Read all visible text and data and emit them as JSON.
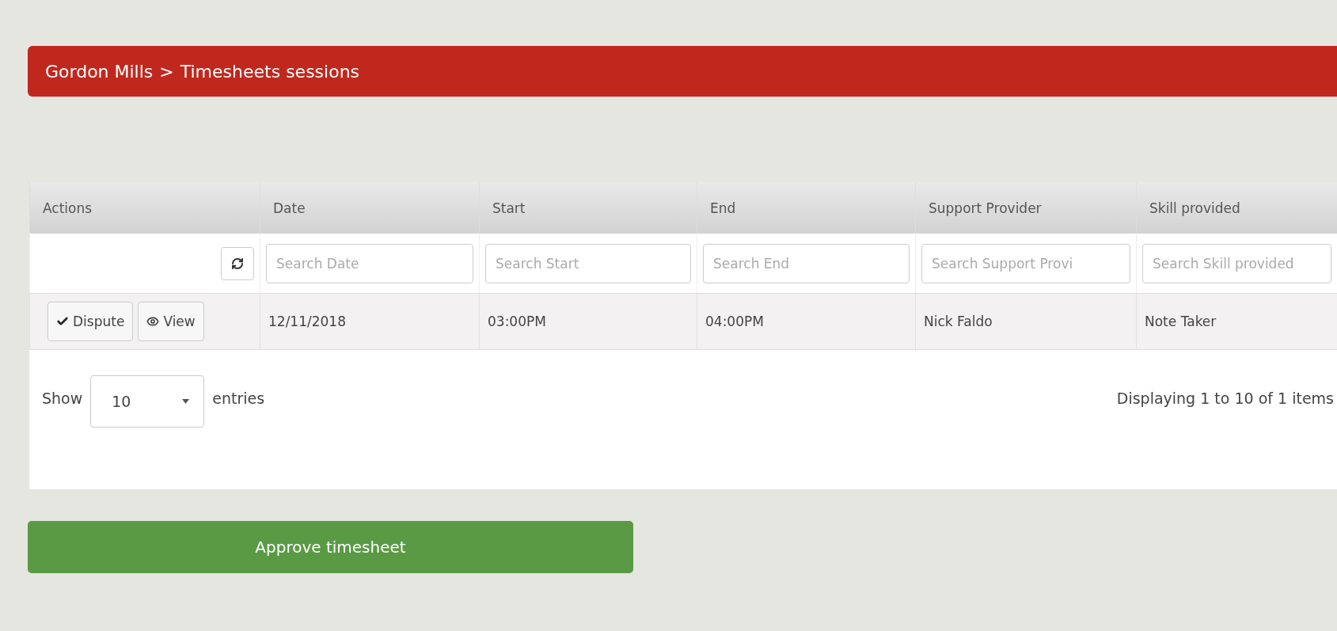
{
  "header": {
    "breadcrumb": [
      {
        "label": "Gordon Mills"
      },
      {
        "label": "Timesheets sessions"
      }
    ],
    "separator": ">"
  },
  "table": {
    "columns": [
      {
        "label": "Actions",
        "kind": "refresh"
      },
      {
        "label": "Date",
        "kind": "search",
        "placeholder": "Search Date"
      },
      {
        "label": "Start",
        "kind": "search",
        "placeholder": "Search Start"
      },
      {
        "label": "End",
        "kind": "search",
        "placeholder": "Search End"
      },
      {
        "label": "Support Provider",
        "kind": "search",
        "placeholder": "Search Support Provi"
      },
      {
        "label": "Skill provided",
        "kind": "search",
        "placeholder": "Search Skill provided"
      }
    ],
    "rows": [
      {
        "cells": [
          {
            "kind": "actions",
            "buttons": [
              {
                "kind": "check",
                "label": "Dispute"
              },
              {
                "kind": "eye",
                "label": "View"
              }
            ]
          },
          {
            "kind": "text",
            "text": "12/11/2018"
          },
          {
            "kind": "text",
            "text": "03:00PM"
          },
          {
            "kind": "text",
            "text": "04:00PM"
          },
          {
            "kind": "text",
            "text": "Nick Faldo"
          },
          {
            "kind": "text",
            "text": "Note Taker"
          }
        ]
      }
    ]
  },
  "footer": {
    "show_label": "Show",
    "page_size": "10",
    "entries_label": "entries",
    "summary": "Displaying 1 to 10 of 1 items"
  },
  "approve_button": "Approve timesheet"
}
